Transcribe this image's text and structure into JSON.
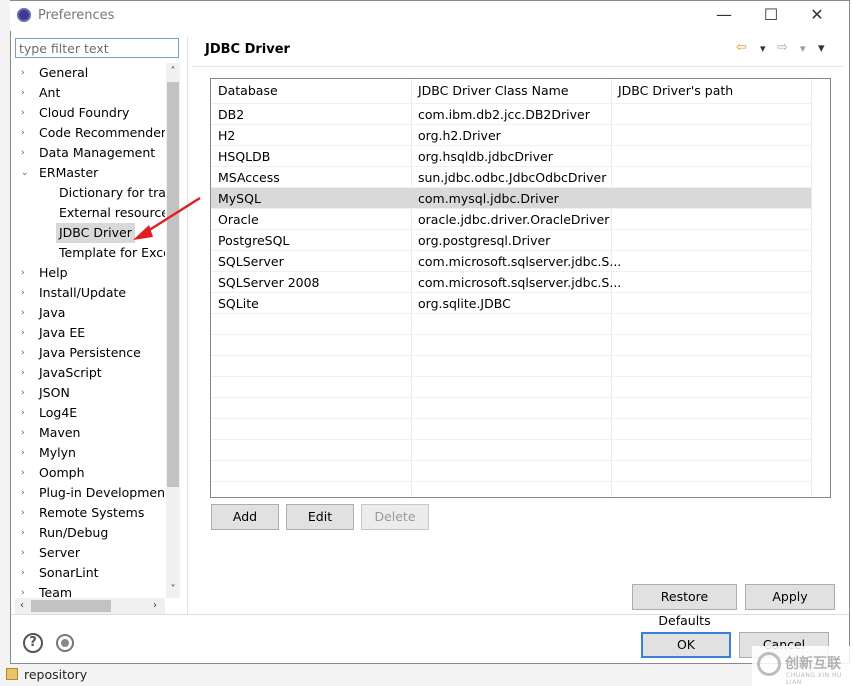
{
  "window": {
    "title": "Preferences",
    "minimize": "—",
    "maximize": "☐",
    "close": "✕"
  },
  "filter": {
    "placeholder": "type filter text"
  },
  "tree": {
    "items": [
      {
        "label": "General",
        "level": 0,
        "arrow": "›"
      },
      {
        "label": "Ant",
        "level": 0,
        "arrow": "›"
      },
      {
        "label": "Cloud Foundry",
        "level": 0,
        "arrow": "›"
      },
      {
        "label": "Code Recommenders",
        "level": 0,
        "arrow": "›"
      },
      {
        "label": "Data Management",
        "level": 0,
        "arrow": "›"
      },
      {
        "label": "ERMaster",
        "level": 0,
        "arrow": "⌄"
      },
      {
        "label": "Dictionary for tran",
        "level": 1,
        "arrow": ""
      },
      {
        "label": "External resources",
        "level": 1,
        "arrow": ""
      },
      {
        "label": "JDBC Driver",
        "level": 1,
        "arrow": "",
        "selected": true
      },
      {
        "label": "Template for Exce",
        "level": 1,
        "arrow": ""
      },
      {
        "label": "Help",
        "level": 0,
        "arrow": "›"
      },
      {
        "label": "Install/Update",
        "level": 0,
        "arrow": "›"
      },
      {
        "label": "Java",
        "level": 0,
        "arrow": "›"
      },
      {
        "label": "Java EE",
        "level": 0,
        "arrow": "›"
      },
      {
        "label": "Java Persistence",
        "level": 0,
        "arrow": "›"
      },
      {
        "label": "JavaScript",
        "level": 0,
        "arrow": "›"
      },
      {
        "label": "JSON",
        "level": 0,
        "arrow": "›"
      },
      {
        "label": "Log4E",
        "level": 0,
        "arrow": "›"
      },
      {
        "label": "Maven",
        "level": 0,
        "arrow": "›"
      },
      {
        "label": "Mylyn",
        "level": 0,
        "arrow": "›"
      },
      {
        "label": "Oomph",
        "level": 0,
        "arrow": "›"
      },
      {
        "label": "Plug-in Development",
        "level": 0,
        "arrow": "›"
      },
      {
        "label": "Remote Systems",
        "level": 0,
        "arrow": "›"
      },
      {
        "label": "Run/Debug",
        "level": 0,
        "arrow": "›"
      },
      {
        "label": "Server",
        "level": 0,
        "arrow": "›"
      },
      {
        "label": "SonarLint",
        "level": 0,
        "arrow": "›"
      },
      {
        "label": "Team",
        "level": 0,
        "arrow": "›"
      }
    ]
  },
  "page": {
    "title": "JDBC Driver",
    "nav": {
      "back": "⇦",
      "back_menu": "▾",
      "forward": "⇨",
      "forward_menu": "▾",
      "view_menu": "▾"
    }
  },
  "table": {
    "columns": [
      "Database",
      "JDBC Driver Class Name",
      "JDBC Driver's path"
    ],
    "rows": [
      {
        "database": "DB2",
        "class": "com.ibm.db2.jcc.DB2Driver",
        "path": ""
      },
      {
        "database": "H2",
        "class": "org.h2.Driver",
        "path": ""
      },
      {
        "database": "HSQLDB",
        "class": "org.hsqldb.jdbcDriver",
        "path": ""
      },
      {
        "database": "MSAccess",
        "class": "sun.jdbc.odbc.JdbcOdbcDriver",
        "path": ""
      },
      {
        "database": "MySQL",
        "class": "com.mysql.jdbc.Driver",
        "path": "",
        "selected": true
      },
      {
        "database": "Oracle",
        "class": "oracle.jdbc.driver.OracleDriver",
        "path": ""
      },
      {
        "database": "PostgreSQL",
        "class": "org.postgresql.Driver",
        "path": ""
      },
      {
        "database": "SQLServer",
        "class": "com.microsoft.sqlserver.jdbc.S...",
        "path": ""
      },
      {
        "database": "SQLServer 2008",
        "class": "com.microsoft.sqlserver.jdbc.S...",
        "path": ""
      },
      {
        "database": "SQLite",
        "class": "org.sqlite.JDBC",
        "path": ""
      }
    ]
  },
  "buttons": {
    "add": "Add",
    "edit": "Edit",
    "delete": "Delete",
    "restore_defaults": "Restore Defaults",
    "apply": "Apply",
    "ok": "OK",
    "cancel": "Cancel"
  },
  "scroll": {
    "up": "˄",
    "down": "˅",
    "left": "‹",
    "right": "›"
  },
  "background": {
    "repository_label": "repository"
  },
  "watermark": {
    "text": "创新互联",
    "sub": "CHUANG XIN HU LIAN"
  },
  "colors": {
    "selection": "#d9d9d9",
    "default_button_border": "#3c7fd6",
    "annotation_arrow": "#e02020"
  }
}
